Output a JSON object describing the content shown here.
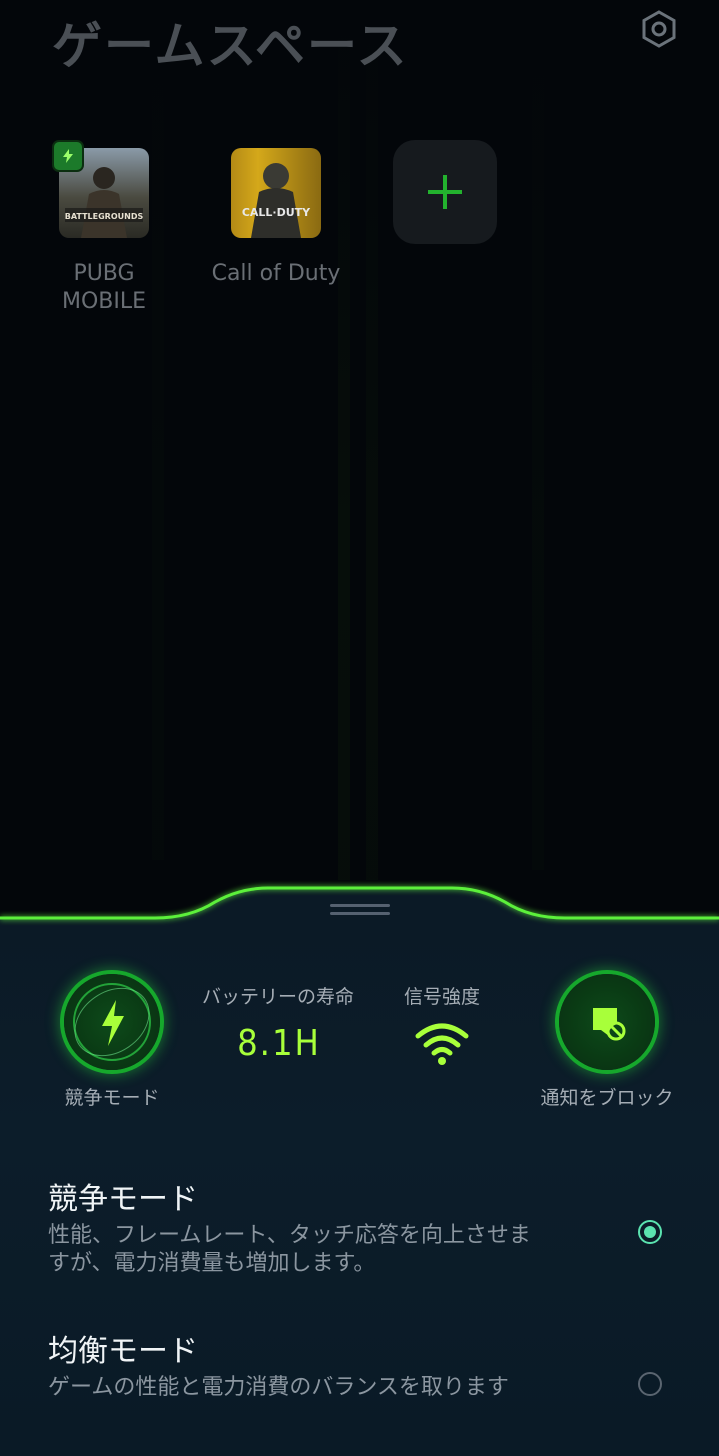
{
  "header": {
    "title": "ゲームスペース"
  },
  "games": [
    {
      "name": "PUBG\nMOBILE",
      "art_text": "BATTLEGROUNDS"
    },
    {
      "name": "Call of Duty",
      "art_text": "CALL·DUTY"
    }
  ],
  "quick_actions": {
    "competition": {
      "label": "競争モード"
    },
    "battery": {
      "title": "バッテリーの寿命",
      "value": "8.1H"
    },
    "signal": {
      "title": "信号強度"
    },
    "block": {
      "label": "通知をブロック"
    }
  },
  "modes": [
    {
      "title": "競争モード",
      "description": "性能、フレームレート、タッチ応答を向上させますが、電力消費量も増加します。",
      "selected": true
    },
    {
      "title": "均衡モード",
      "description": "ゲームの性能と電力消費のバランスを取ります",
      "selected": false
    }
  ],
  "colors": {
    "accent": "#a8ff3a",
    "glow": "#3ce12a",
    "radio": "#5be3b0"
  }
}
